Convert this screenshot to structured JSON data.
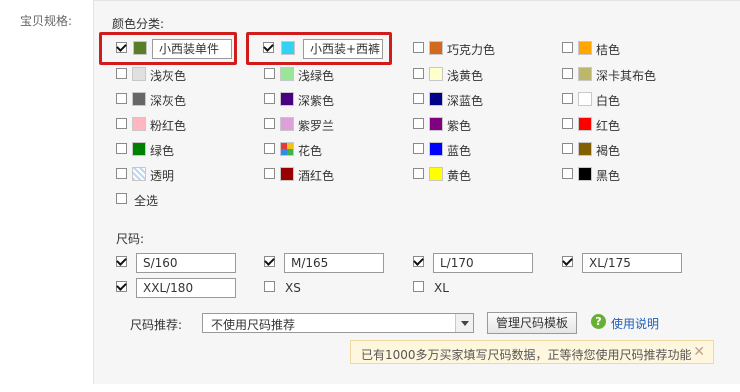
{
  "form_label": "宝贝规格:",
  "color_section": {
    "title": "颜色分类:",
    "custom_entries": [
      {
        "checked": true,
        "swatch": "#5a7d2a",
        "value": "小西装单件"
      },
      {
        "checked": true,
        "swatch": "#33d1f2",
        "value": "小西装+西裤"
      }
    ],
    "colors": [
      {
        "label": "巧克力色",
        "swatch": "#d2691e",
        "checked": false
      },
      {
        "label": "桔色",
        "swatch": "#ffa500",
        "checked": false
      },
      {
        "label": "浅灰色",
        "swatch": "#e0e0e0",
        "checked": false
      },
      {
        "label": "浅绿色",
        "swatch": "#99e699",
        "checked": false
      },
      {
        "label": "浅黄色",
        "swatch": "#ffffcc",
        "checked": false
      },
      {
        "label": "深卡其布色",
        "swatch": "#bdb76b",
        "checked": false
      },
      {
        "label": "深灰色",
        "swatch": "#666666",
        "checked": false
      },
      {
        "label": "深紫色",
        "swatch": "#4b0082",
        "checked": false
      },
      {
        "label": "深蓝色",
        "swatch": "#00008b",
        "checked": false
      },
      {
        "label": "白色",
        "swatch": "#ffffff",
        "checked": false
      },
      {
        "label": "粉红色",
        "swatch": "#ffb6c1",
        "checked": false
      },
      {
        "label": "紫罗兰",
        "swatch": "#dda0dd",
        "checked": false
      },
      {
        "label": "紫色",
        "swatch": "#800080",
        "checked": false
      },
      {
        "label": "红色",
        "swatch": "#ff0000",
        "checked": false
      },
      {
        "label": "绿色",
        "swatch": "#008000",
        "checked": false
      },
      {
        "label": "花色",
        "swatch": "flower",
        "checked": false
      },
      {
        "label": "蓝色",
        "swatch": "#0000ff",
        "checked": false
      },
      {
        "label": "褐色",
        "swatch": "#855e00",
        "checked": false
      },
      {
        "label": "透明",
        "swatch": "transparent",
        "checked": false
      },
      {
        "label": "酒红色",
        "swatch": "#990000",
        "checked": false
      },
      {
        "label": "黄色",
        "swatch": "#ffff00",
        "checked": false
      },
      {
        "label": "黑色",
        "swatch": "#000000",
        "checked": false
      }
    ],
    "select_all": "全选"
  },
  "size_section": {
    "title": "尺码:",
    "sizes": [
      {
        "value": "S/160",
        "checked": true
      },
      {
        "value": "M/165",
        "checked": true
      },
      {
        "value": "L/170",
        "checked": true
      },
      {
        "value": "XL/175",
        "checked": true
      },
      {
        "value": "XXL/180",
        "checked": true
      },
      {
        "value": "XS",
        "checked": false
      },
      {
        "value": "XL",
        "checked": false
      }
    ]
  },
  "size_recommend": {
    "label": "尺码推荐:",
    "selected": "不使用尺码推荐",
    "manage_button": "管理尺码模板",
    "help_link": "使用说明",
    "tip": "已有1000多万买家填写尺码数据，正等待您使用尺码推荐功能"
  }
}
